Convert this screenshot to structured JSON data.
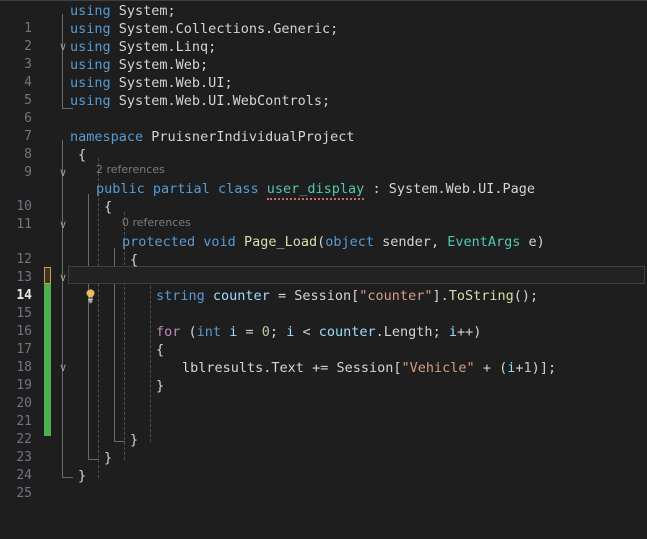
{
  "editor": {
    "app": "visual-studio-code-editor",
    "theme": "dark",
    "background": "#1e1e1e",
    "active_line": 14,
    "total_lines": 25,
    "line_numbers": [
      "1",
      "2",
      "3",
      "4",
      "5",
      "6",
      "7",
      "8",
      "9",
      "10",
      "11",
      "12",
      "13",
      "14",
      "15",
      "16",
      "17",
      "18",
      "19",
      "20",
      "21",
      "22",
      "23",
      "24",
      "25"
    ]
  },
  "colors": {
    "keyword": "#569cd6",
    "control_keyword": "#c586c0",
    "type": "#4ec9b0",
    "method": "#dcdcaa",
    "string": "#d69d85",
    "number": "#b5cea8",
    "local_variable": "#9cdcfe",
    "plain": "#d4d4d4",
    "line_number": "#6e7681",
    "codelens": "#7b7b7b",
    "change_bar": "#4caf50",
    "change_mark_border": "#c8a13a",
    "error_squiggle": "#d16969"
  },
  "gutter": {
    "lightbulb_line": 14,
    "lightbulb_icon": "lightbulb-icon",
    "fold_chevron_icon": "chevron-down-icon",
    "fold_chevron_lines": [
      1,
      8,
      10,
      12
    ]
  },
  "codelens": [
    {
      "line": 10,
      "text": "2 references"
    },
    {
      "line": 12,
      "text": "0 references"
    }
  ],
  "code_lines": {
    "l1": "using System;",
    "l2": "using System.Collections.Generic;",
    "l3": "using System.Linq;",
    "l4": "using System.Web;",
    "l5": "using System.Web.UI;",
    "l6": "using System.Web.UI.WebControls;",
    "l7": "",
    "l8": "namespace PruisnerIndividualProject",
    "l9": "{",
    "l10": "    public partial class user_display : System.Web.UI.Page",
    "l11": "    {",
    "l12": "        protected void Page_Load(object sender, EventArgs e)",
    "l13": "        {",
    "l14": "",
    "l15": "            string counter = Session[\"counter\"].ToString();",
    "l16": "",
    "l17": "            for (int i = 0; i < counter.Length; i++)",
    "l18": "            {",
    "l19": "                lblresults.Text += Session[\"Vehicle\" + (i+1)];",
    "l20": "            }",
    "l21": "",
    "l22": "",
    "l23": "        }",
    "l24": "    }",
    "l25": "}"
  },
  "tokens": {
    "kw_using": "using",
    "kw_namespace": "namespace",
    "kw_public": "public",
    "kw_partial": "partial",
    "kw_class": "class",
    "kw_protected": "protected",
    "kw_void": "void",
    "kw_string": "string",
    "kw_object": "object",
    "kw_int": "int",
    "kw_for": "for",
    "ns_system": "System;",
    "ns_collections": "System.Collections.Generic;",
    "ns_linq": "System.Linq;",
    "ns_web": "System.Web;",
    "ns_webui": "System.Web.UI;",
    "ns_webcontrols": "System.Web.UI.WebControls;",
    "namespace_name": "PruisnerIndividualProject",
    "class_name": "user_display",
    "base_class": "System.Web.UI.Page",
    "method_name": "Page_Load",
    "param_sender": "sender",
    "type_eventargs": "EventArgs",
    "param_e": "e",
    "var_counter": "counter",
    "obj_session": "Session",
    "str_counter": "\"counter\"",
    "mth_tostring": "ToString",
    "var_i": "i",
    "num_zero": "0",
    "num_one": "1",
    "prop_length": "Length",
    "label_lblresults": "lblresults",
    "prop_text": "Text",
    "str_vehicle": "\"Vehicle\"",
    "brace_open": "{",
    "brace_close": "}",
    "colon": ":",
    "semicolon": ";",
    "comma": ",",
    "paren_open": "(",
    "paren_close": ")",
    "bracket_open": "[",
    "bracket_close": "]",
    "eq": "=",
    "plus_eq": "+=",
    "lt": "<",
    "plus": "+",
    "inc": "++",
    "dot": "."
  }
}
